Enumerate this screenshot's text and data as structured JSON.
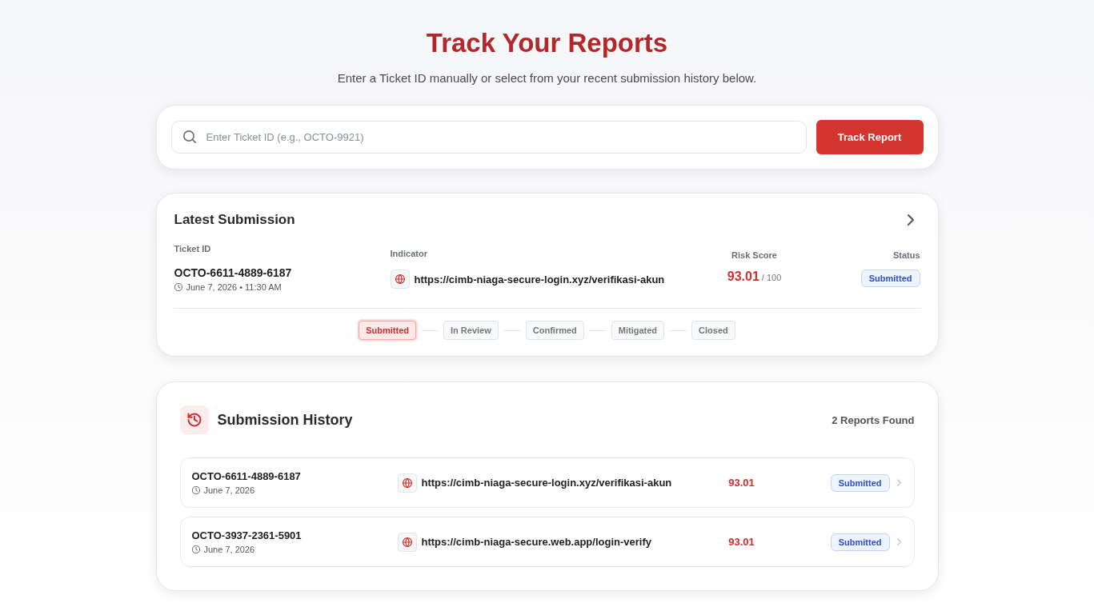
{
  "header": {
    "title": "Track Your Reports",
    "subtitle": "Enter a Ticket ID manually or select from your recent submission history below."
  },
  "search": {
    "placeholder": "Enter Ticket ID (e.g., OCTO-9921)",
    "button": "Track Report"
  },
  "latest_submission": {
    "title": "Latest Submission",
    "columns": {
      "ticket_id": "Ticket ID",
      "indicator": "Indicator",
      "risk_score": "Risk Score",
      "status": "Status"
    },
    "ticket_id": "OCTO-6611-4889-6187",
    "date": "June 7, 2026 • 11:30 AM",
    "indicator": "https://cimb-niaga-secure-login.xyz/verifikasi-akun",
    "risk_score": "93.01",
    "risk_max": "/ 100",
    "status": "Submitted",
    "steps": [
      {
        "label": "Submitted",
        "active": true
      },
      {
        "label": "In Review",
        "active": false
      },
      {
        "label": "Confirmed",
        "active": false
      },
      {
        "label": "Mitigated",
        "active": false
      },
      {
        "label": "Closed",
        "active": false
      }
    ]
  },
  "history": {
    "title": "Submission History",
    "count": "2 Reports Found",
    "rows": [
      {
        "ticket_id": "OCTO-6611-4889-6187",
        "date": "June 7, 2026",
        "indicator": "https://cimb-niaga-secure-login.xyz/verifikasi-akun",
        "risk_score": "93.01",
        "status": "Submitted"
      },
      {
        "ticket_id": "OCTO-3937-2361-5901",
        "date": "June 7, 2026",
        "indicator": "https://cimb-niaga-secure.web.app/login-verify",
        "risk_score": "93.01",
        "status": "Submitted"
      }
    ]
  }
}
